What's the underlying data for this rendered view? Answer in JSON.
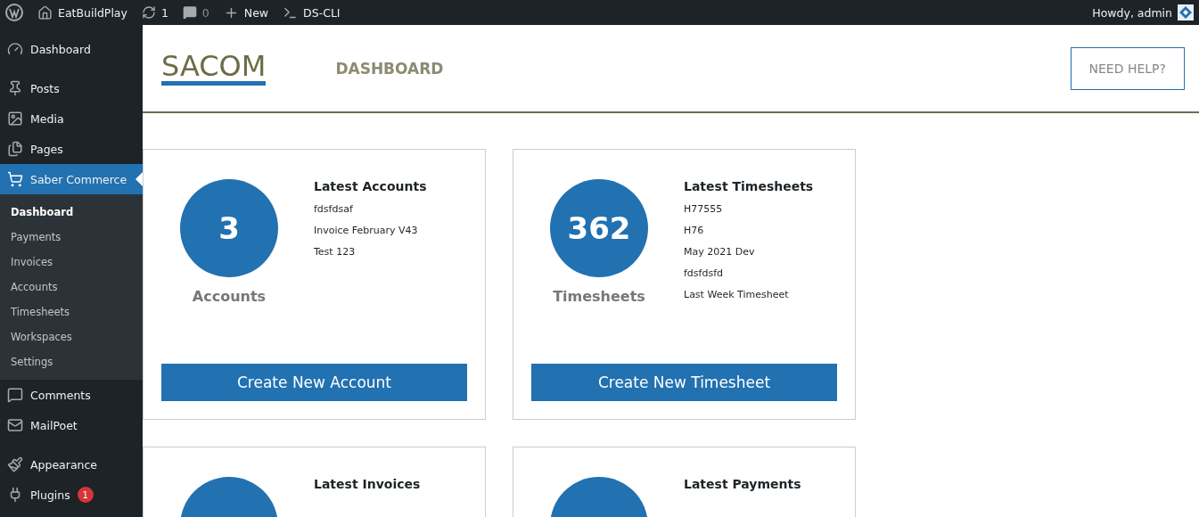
{
  "admin_bar": {
    "items": [
      {
        "kind": "logo"
      },
      {
        "kind": "site",
        "label": "EatBuildPlay"
      },
      {
        "kind": "updates",
        "label": "1"
      },
      {
        "kind": "comments",
        "label": "0"
      },
      {
        "kind": "new",
        "label": "New"
      },
      {
        "kind": "terminal",
        "label": "DS-CLI"
      }
    ],
    "greeting": "Howdy, admin"
  },
  "sidebar": {
    "items": [
      {
        "kind": "dashboard",
        "label": "Dashboard",
        "selected": false
      },
      {
        "kind": "posts",
        "label": "Posts",
        "selected": false
      },
      {
        "kind": "media",
        "label": "Media",
        "selected": false
      },
      {
        "kind": "pages",
        "label": "Pages",
        "selected": false
      },
      {
        "kind": "commerce",
        "label": "Saber Commerce",
        "selected": true,
        "children": [
          {
            "label": "Dashboard",
            "selected": true
          },
          {
            "label": "Payments",
            "selected": false
          },
          {
            "label": "Invoices",
            "selected": false
          },
          {
            "label": "Accounts",
            "selected": false
          },
          {
            "label": "Timesheets",
            "selected": false
          },
          {
            "label": "Workspaces",
            "selected": false
          },
          {
            "label": "Settings",
            "selected": false
          }
        ]
      },
      {
        "kind": "comments",
        "label": "Comments",
        "selected": false
      },
      {
        "kind": "mail",
        "label": "MailPoet",
        "selected": false
      },
      {
        "kind": "appearance",
        "label": "Appearance",
        "selected": false
      },
      {
        "kind": "plugins",
        "label": "Plugins",
        "selected": false,
        "badge": "1"
      }
    ]
  },
  "header": {
    "logo": "SACOM",
    "title": "DASHBOARD",
    "help_button": "NEED HELP?"
  },
  "cards": [
    {
      "count": "3",
      "label": "Accounts",
      "list_title": "Latest Accounts",
      "items": [
        "fdsfdsaf",
        "Invoice February V43",
        "Test 123"
      ],
      "button": "Create New Account"
    },
    {
      "count": "362",
      "label": "Timesheets",
      "list_title": "Latest Timesheets",
      "items": [
        "H77555",
        "H76",
        "May 2021 Dev",
        "fdsfdsfd",
        "Last Week Timesheet"
      ],
      "button": "Create New Timesheet"
    },
    {
      "list_title": "Latest Invoices"
    },
    {
      "list_title": "Latest Payments"
    }
  ]
}
